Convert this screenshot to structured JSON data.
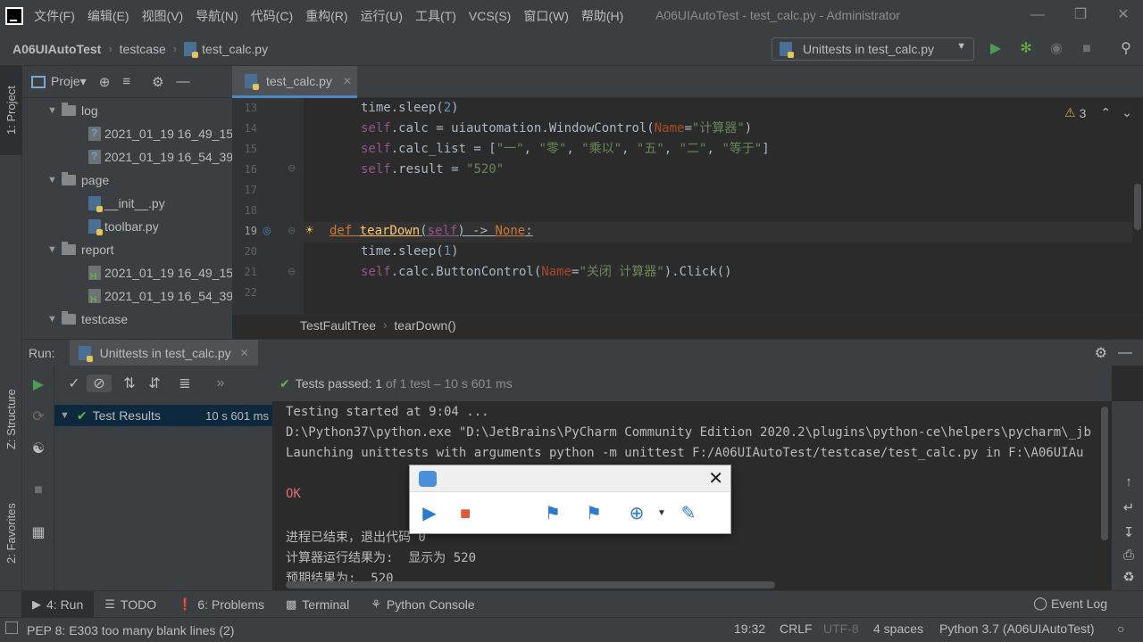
{
  "menu": {
    "items": [
      "文件(F)",
      "编辑(E)",
      "视图(V)",
      "导航(N)",
      "代码(C)",
      "重构(R)",
      "运行(U)",
      "工具(T)",
      "VCS(S)",
      "窗口(W)",
      "帮助(H)"
    ],
    "window_title": "A06UIAutoTest - test_calc.py - Administrator"
  },
  "navbar": {
    "crumbs": [
      "A06UIAutoTest",
      "testcase",
      "test_calc.py"
    ],
    "run_config": "Unittests in test_calc.py"
  },
  "left_stripe": {
    "project": "1: Project",
    "structure": "Z: Structure",
    "favorites": "2: Favorites"
  },
  "project_panel": {
    "title": "Proje▾",
    "tree": [
      {
        "label": "log",
        "kind": "folder",
        "indent": 1
      },
      {
        "label": "2021_01_19 16_49_15",
        "kind": "log",
        "indent": 2
      },
      {
        "label": "2021_01_19 16_54_39",
        "kind": "log",
        "indent": 2
      },
      {
        "label": "page",
        "kind": "folder",
        "indent": 1
      },
      {
        "label": "__init__.py",
        "kind": "py",
        "indent": 2
      },
      {
        "label": "toolbar.py",
        "kind": "py",
        "indent": 2
      },
      {
        "label": "report",
        "kind": "folder",
        "indent": 1
      },
      {
        "label": "2021_01_19 16_49_15",
        "kind": "html",
        "indent": 2
      },
      {
        "label": "2021_01_19 16_54_39",
        "kind": "html",
        "indent": 2
      },
      {
        "label": "testcase",
        "kind": "folder",
        "indent": 1
      }
    ]
  },
  "editor": {
    "tab": "test_calc.py",
    "warnings": "3",
    "line_numbers": [
      "13",
      "14",
      "15",
      "16",
      "17",
      "18",
      "19",
      "20",
      "21",
      "22"
    ],
    "lines": [
      {
        "ind": 1,
        "tokens": [
          {
            "t": "time.sleep(",
            "c": "plain"
          },
          {
            "t": "2",
            "c": "num"
          },
          {
            "t": ")",
            "c": "plain"
          }
        ]
      },
      {
        "ind": 1,
        "tokens": [
          {
            "t": "self",
            "c": "self"
          },
          {
            "t": ".calc = uiautomation.WindowControl(",
            "c": "plain"
          },
          {
            "t": "Name",
            "c": "param"
          },
          {
            "t": "=",
            "c": "plain"
          },
          {
            "t": "\"计算器\"",
            "c": "str"
          },
          {
            "t": ")",
            "c": "plain"
          }
        ]
      },
      {
        "ind": 1,
        "tokens": [
          {
            "t": "self",
            "c": "self"
          },
          {
            "t": ".calc_list = [",
            "c": "plain"
          },
          {
            "t": "\"一\"",
            "c": "str"
          },
          {
            "t": ", ",
            "c": "plain"
          },
          {
            "t": "\"零\"",
            "c": "str"
          },
          {
            "t": ", ",
            "c": "plain"
          },
          {
            "t": "\"乘以\"",
            "c": "str"
          },
          {
            "t": ", ",
            "c": "plain"
          },
          {
            "t": "\"五\"",
            "c": "str"
          },
          {
            "t": ", ",
            "c": "plain"
          },
          {
            "t": "\"二\"",
            "c": "str"
          },
          {
            "t": ", ",
            "c": "plain"
          },
          {
            "t": "\"等于\"",
            "c": "str"
          },
          {
            "t": "]",
            "c": "plain"
          }
        ]
      },
      {
        "ind": 1,
        "tokens": [
          {
            "t": "self",
            "c": "self"
          },
          {
            "t": ".result = ",
            "c": "plain"
          },
          {
            "t": "\"520\"",
            "c": "str"
          }
        ]
      },
      {
        "ind": 0,
        "tokens": []
      },
      {
        "ind": 0,
        "tokens": []
      },
      {
        "ind": 0,
        "tokens": [
          {
            "t": "def ",
            "c": "kw"
          },
          {
            "t": "tearDown",
            "c": "fn"
          },
          {
            "t": "(",
            "c": "plain"
          },
          {
            "t": "self",
            "c": "self"
          },
          {
            "t": ") -> ",
            "c": "plain"
          },
          {
            "t": "None",
            "c": "kw"
          },
          {
            "t": ":",
            "c": "plain"
          }
        ]
      },
      {
        "ind": 1,
        "tokens": [
          {
            "t": "time.sleep(",
            "c": "plain"
          },
          {
            "t": "1",
            "c": "num"
          },
          {
            "t": ")",
            "c": "plain"
          }
        ]
      },
      {
        "ind": 1,
        "tokens": [
          {
            "t": "self",
            "c": "self"
          },
          {
            "t": ".calc.ButtonControl(",
            "c": "plain"
          },
          {
            "t": "Name",
            "c": "param"
          },
          {
            "t": "=",
            "c": "plain"
          },
          {
            "t": "\"关闭 计算器\"",
            "c": "str"
          },
          {
            "t": ").Click()",
            "c": "plain"
          }
        ]
      },
      {
        "ind": 0,
        "tokens": []
      }
    ],
    "breadcrumb": [
      "TestFaultTree",
      "tearDown()"
    ]
  },
  "run_panel": {
    "label": "Run:",
    "tab": "Unittests in test_calc.py",
    "tests_passed": "Tests passed: 1",
    "tests_detail": "of 1 test – 10 s 601 ms",
    "test_results": "Test Results",
    "test_results_time": "10 s 601 ms",
    "console": [
      {
        "text": "Testing started at 9:04 ...",
        "style": "plain"
      },
      {
        "text": "D:\\Python37\\python.exe \"D:\\JetBrains\\PyCharm Community Edition 2020.2\\plugins\\python-ce\\helpers\\pycharm\\_jb",
        "style": "plain"
      },
      {
        "text": "Launching unittests with arguments python -m unittest F:/A06UIAutoTest/testcase/test_calc.py in F:\\A06UIAu",
        "style": "plain"
      },
      {
        "text": "",
        "style": "plain"
      },
      {
        "text": "OK",
        "style": "ok"
      },
      {
        "text": "",
        "style": "plain"
      },
      {
        "text": "进程已结束，退出代码 0",
        "style": "plain"
      },
      {
        "text": "计算器运行结果为:  显示为 520",
        "style": "plain"
      },
      {
        "text": "预期结果为:  520",
        "style": "plain"
      }
    ]
  },
  "toolwindows": {
    "run": "4: Run",
    "todo": "TODO",
    "problems": "6: Problems",
    "terminal": "Terminal",
    "python_console": "Python Console",
    "event_log": "Event Log"
  },
  "status": {
    "message": "PEP 8: E303 too many blank lines (2)",
    "position": "19:32",
    "line_sep": "CRLF",
    "encoding": "UTF-8",
    "indent": "4 spaces",
    "interpreter": "Python 3.7 (A06UIAutoTest)"
  },
  "colors": {
    "accent": "#4a88c7",
    "pass_green": "#62b543",
    "run_green": "#499c54",
    "stop_red": "#e05a3a"
  }
}
